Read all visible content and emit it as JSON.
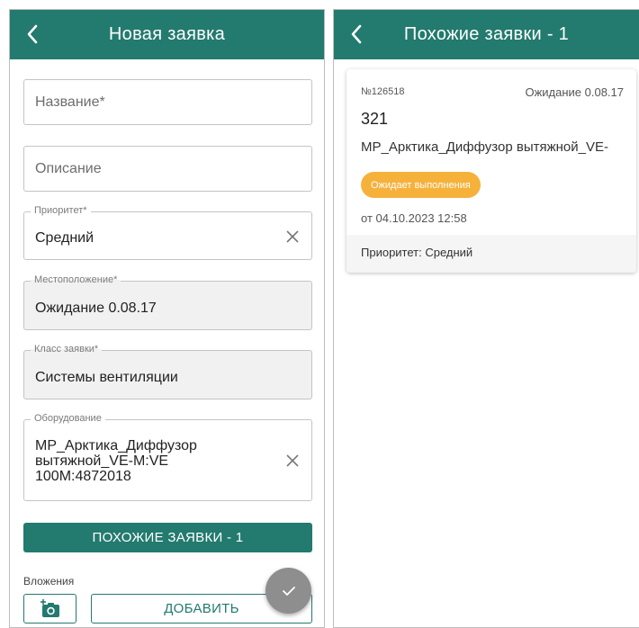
{
  "left": {
    "title": "Новая заявка",
    "name_placeholder": "Название*",
    "description_placeholder": "Описание",
    "priority": {
      "label": "Приоритет*",
      "value": "Средний"
    },
    "location": {
      "label": "Местоположение*",
      "value": "Ожидание 0.08.17"
    },
    "request_class": {
      "label": "Класс заявки*",
      "value": "Системы вентиляции"
    },
    "equipment": {
      "label": "Оборудование",
      "line1": "MP_Арктика_Диффузор",
      "line2": "вытяжной_VE-M:VE",
      "line3": "100M:4872018"
    },
    "similar_button": "ПОХОЖИЕ ЗАЯВКИ - 1",
    "attachments_label": "Вложения",
    "add_button": "ДОБАВИТЬ"
  },
  "right": {
    "title": "Похожие заявки - 1",
    "card": {
      "number": "№126518",
      "location": "Ожидание 0.08.17",
      "code": "321",
      "equipment": "MP_Арктика_Диффузор вытяжной_VE-",
      "status": "Ожидает выполнения",
      "date": "от 04.10.2023 12:58",
      "priority": "Приоритет: Средний"
    }
  },
  "colors": {
    "primary": "#237a6e",
    "status": "#f6b13b",
    "fab": "#8e8e8e"
  },
  "icons": {
    "back": "chevron-left-icon",
    "clear": "close-icon",
    "camera": "add-photo-icon",
    "submit": "check-icon"
  }
}
